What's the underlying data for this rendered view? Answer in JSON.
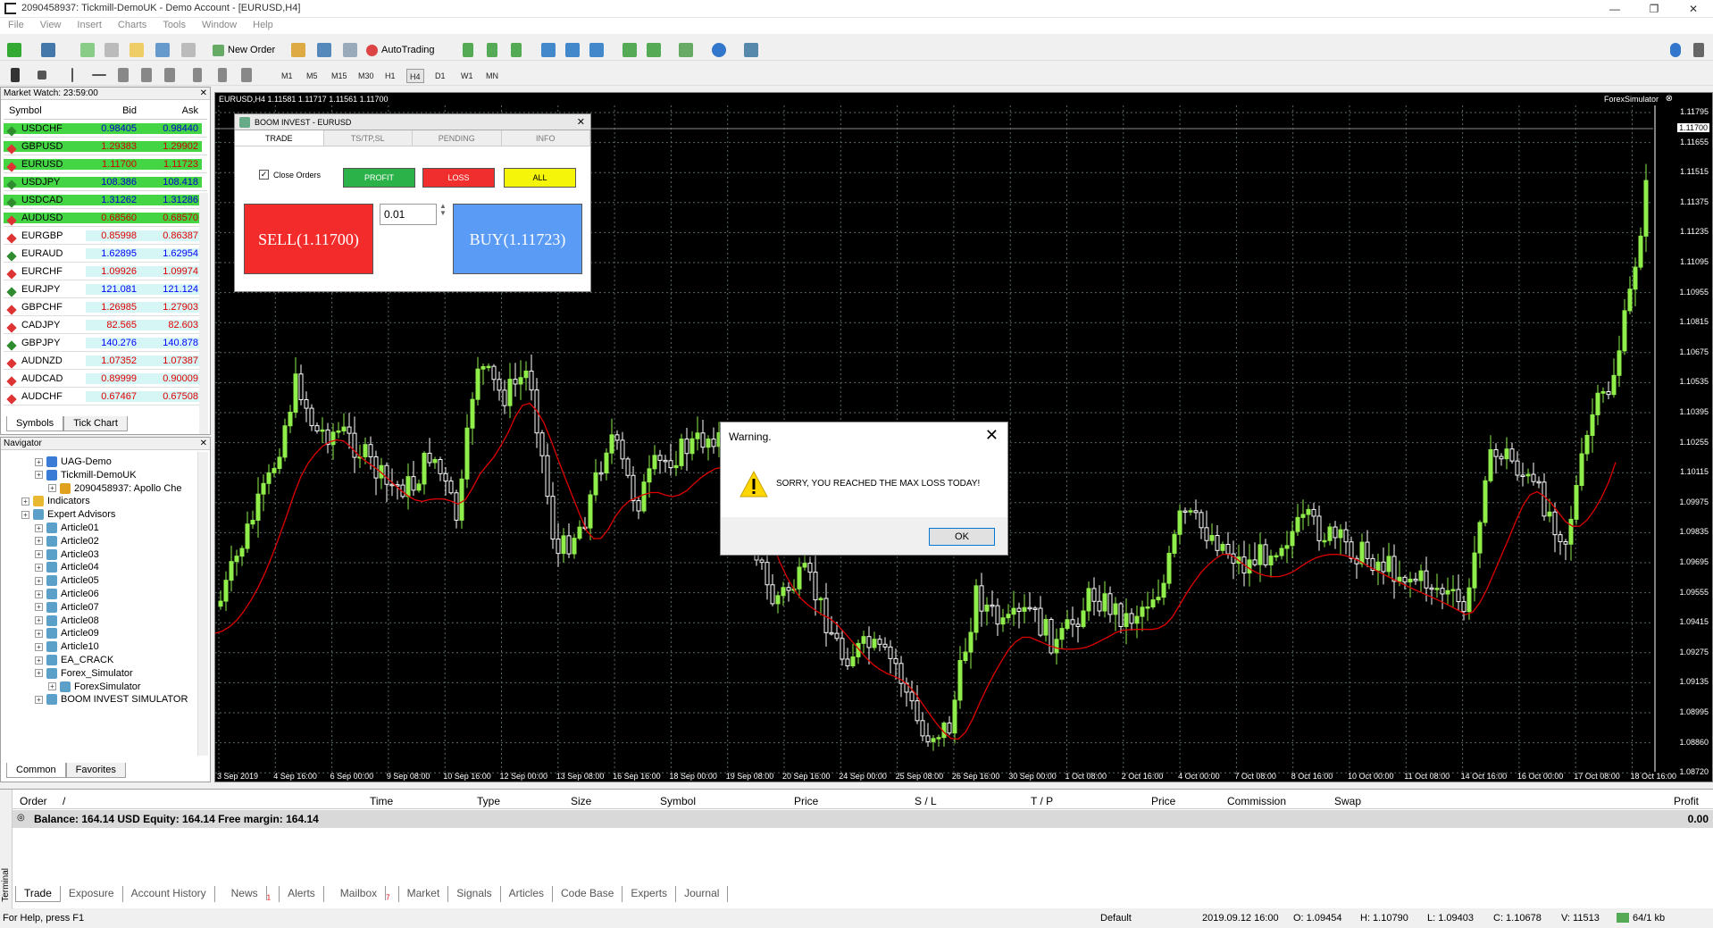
{
  "window": {
    "title": "2090458937: Tickmill-DemoUK - Demo Account - [EURUSD,H4]",
    "min": "—",
    "restore": "❐",
    "close": "✕"
  },
  "menu": [
    "File",
    "View",
    "Insert",
    "Charts",
    "Tools",
    "Window",
    "Help"
  ],
  "toolbar": {
    "new_order": "New Order",
    "auto_trading": "AutoTrading",
    "timeframes": [
      "M1",
      "M5",
      "M15",
      "M30",
      "H1",
      "H4",
      "D1",
      "W1",
      "MN"
    ],
    "active_timeframe": "H4"
  },
  "market_watch": {
    "title": "Market Watch: 23:59:00",
    "headers": {
      "symbol": "Symbol",
      "bid": "Bid",
      "ask": "Ask"
    },
    "rows": [
      {
        "symbol": "USDCHF",
        "bid": "0.98405",
        "ask": "0.98440",
        "dir": "up",
        "hl": true
      },
      {
        "symbol": "GBPUSD",
        "bid": "1.29383",
        "ask": "1.29902",
        "dir": "dn",
        "hl": true
      },
      {
        "symbol": "EURUSD",
        "bid": "1.11700",
        "ask": "1.11723",
        "dir": "dn",
        "hl": true
      },
      {
        "symbol": "USDJPY",
        "bid": "108.386",
        "ask": "108.418",
        "dir": "up",
        "hl": true
      },
      {
        "symbol": "USDCAD",
        "bid": "1.31262",
        "ask": "1.31286",
        "dir": "up",
        "hl": true
      },
      {
        "symbol": "AUDUSD",
        "bid": "0.68560",
        "ask": "0.68570",
        "dir": "dn",
        "hl": true
      },
      {
        "symbol": "EURGBP",
        "bid": "0.85998",
        "ask": "0.86387",
        "dir": "dn",
        "hl": false
      },
      {
        "symbol": "EURAUD",
        "bid": "1.62895",
        "ask": "1.62954",
        "dir": "up",
        "hl": false
      },
      {
        "symbol": "EURCHF",
        "bid": "1.09926",
        "ask": "1.09974",
        "dir": "dn",
        "hl": false
      },
      {
        "symbol": "EURJPY",
        "bid": "121.081",
        "ask": "121.124",
        "dir": "up",
        "hl": false
      },
      {
        "symbol": "GBPCHF",
        "bid": "1.26985",
        "ask": "1.27903",
        "dir": "dn",
        "hl": false
      },
      {
        "symbol": "CADJPY",
        "bid": "82.565",
        "ask": "82.603",
        "dir": "dn",
        "hl": false
      },
      {
        "symbol": "GBPJPY",
        "bid": "140.276",
        "ask": "140.878",
        "dir": "up",
        "hl": false
      },
      {
        "symbol": "AUDNZD",
        "bid": "1.07352",
        "ask": "1.07387",
        "dir": "dn",
        "hl": false
      },
      {
        "symbol": "AUDCAD",
        "bid": "0.89999",
        "ask": "0.90009",
        "dir": "dn",
        "hl": false
      },
      {
        "symbol": "AUDCHF",
        "bid": "0.67467",
        "ask": "0.67508",
        "dir": "dn",
        "hl": false
      }
    ],
    "tabs": [
      "Symbols",
      "Tick Chart"
    ]
  },
  "navigator": {
    "title": "Navigator",
    "items": [
      {
        "label": "UAG-Demo",
        "indent": 2,
        "icon": "server-icon"
      },
      {
        "label": "Tickmill-DemoUK",
        "indent": 2,
        "icon": "server-icon"
      },
      {
        "label": "2090458937: Apollo Che",
        "indent": 3,
        "icon": "account-icon"
      },
      {
        "label": "Indicators",
        "indent": 1,
        "icon": "indicator-icon"
      },
      {
        "label": "Expert Advisors",
        "indent": 1,
        "icon": "expert-icon"
      },
      {
        "label": "Article01",
        "indent": 2,
        "icon": "expert-icon"
      },
      {
        "label": "Article02",
        "indent": 2,
        "icon": "expert-icon"
      },
      {
        "label": "Article03",
        "indent": 2,
        "icon": "expert-icon"
      },
      {
        "label": "Article04",
        "indent": 2,
        "icon": "expert-icon"
      },
      {
        "label": "Article05",
        "indent": 2,
        "icon": "expert-icon"
      },
      {
        "label": "Article06",
        "indent": 2,
        "icon": "expert-icon"
      },
      {
        "label": "Article07",
        "indent": 2,
        "icon": "expert-icon"
      },
      {
        "label": "Article08",
        "indent": 2,
        "icon": "expert-icon"
      },
      {
        "label": "Article09",
        "indent": 2,
        "icon": "expert-icon"
      },
      {
        "label": "Article10",
        "indent": 2,
        "icon": "expert-icon"
      },
      {
        "label": "EA_CRACK",
        "indent": 2,
        "icon": "expert-icon"
      },
      {
        "label": "Forex_Simulator",
        "indent": 2,
        "icon": "expert-icon"
      },
      {
        "label": "ForexSimulator",
        "indent": 3,
        "icon": "expert-icon"
      },
      {
        "label": "BOOM INVEST SIMULATOR",
        "indent": 2,
        "icon": "expert-icon"
      }
    ],
    "tabs": [
      "Common",
      "Favorites"
    ]
  },
  "chart": {
    "header": "EURUSD,H4  1.11581 1.11717 1.11561 1.11700",
    "indicator": "ForexSimulator",
    "current_price": "1.11700",
    "y_labels": [
      "1.11795",
      "1.11655",
      "1.11515",
      "1.11375",
      "1.11235",
      "1.11095",
      "1.10955",
      "1.10815",
      "1.10675",
      "1.10535",
      "1.10395",
      "1.10255",
      "1.10115",
      "1.09975",
      "1.09835",
      "1.09695",
      "1.09555",
      "1.09415",
      "1.09275",
      "1.09135",
      "1.08995",
      "1.08860",
      "1.08720"
    ],
    "x_labels": [
      "3 Sep 2019",
      "4 Sep 16:00",
      "6 Sep 00:00",
      "9 Sep 08:00",
      "10 Sep 16:00",
      "12 Sep 00:00",
      "13 Sep 08:00",
      "16 Sep 16:00",
      "18 Sep 00:00",
      "19 Sep 08:00",
      "20 Sep 16:00",
      "24 Sep 00:00",
      "25 Sep 08:00",
      "26 Sep 16:00",
      "30 Sep 00:00",
      "1 Oct 08:00",
      "2 Oct 16:00",
      "4 Oct 00:00",
      "7 Oct 08:00",
      "8 Oct 16:00",
      "10 Oct 00:00",
      "11 Oct 08:00",
      "14 Oct 16:00",
      "16 Oct 00:00",
      "17 Oct 08:00",
      "18 Oct 16:00"
    ],
    "colors": {
      "bull": "#90ee4a",
      "bear": "#ffffff",
      "ma": "#e00000",
      "grid": "#5a6a6a"
    }
  },
  "ea_panel": {
    "title": "BOOM INVEST - EURUSD",
    "tabs": [
      "TRADE",
      "TS/TP,SL",
      "PENDING",
      "INFO"
    ],
    "close_orders": "Close Orders",
    "profit": "PROFIT",
    "loss": "LOSS",
    "all": "ALL",
    "lot": "0.01",
    "sell": "SELL(1.11700)",
    "buy": "BUY(1.11723)"
  },
  "warning": {
    "title": "Warning.",
    "message": "SORRY, YOU REACHED THE MAX LOSS TODAY!",
    "ok": "OK"
  },
  "terminal": {
    "side_label": "Terminal",
    "headers": [
      "Order",
      "/",
      "Time",
      "Type",
      "Size",
      "Symbol",
      "Price",
      "S / L",
      "T / P",
      "Price",
      "Commission",
      "Swap",
      "Profit"
    ],
    "balance_line": "Balance: 164.14 USD  Equity: 164.14  Free margin: 164.14",
    "profit_total": "0.00",
    "tabs": [
      "Trade",
      "Exposure",
      "Account History",
      "News",
      "Alerts",
      "Mailbox",
      "Market",
      "Signals",
      "Articles",
      "Code Base",
      "Experts",
      "Journal"
    ],
    "news_badge": "1",
    "mailbox_badge": "7"
  },
  "status": {
    "help": "For Help, press F1",
    "profile": "Default",
    "datetime": "2019.09.12 16:00",
    "open": "O: 1.09454",
    "high": "H: 1.10790",
    "low": "L: 1.09403",
    "close": "C: 1.10678",
    "volume": "V: 11513",
    "traffic": "64/1 kb"
  }
}
